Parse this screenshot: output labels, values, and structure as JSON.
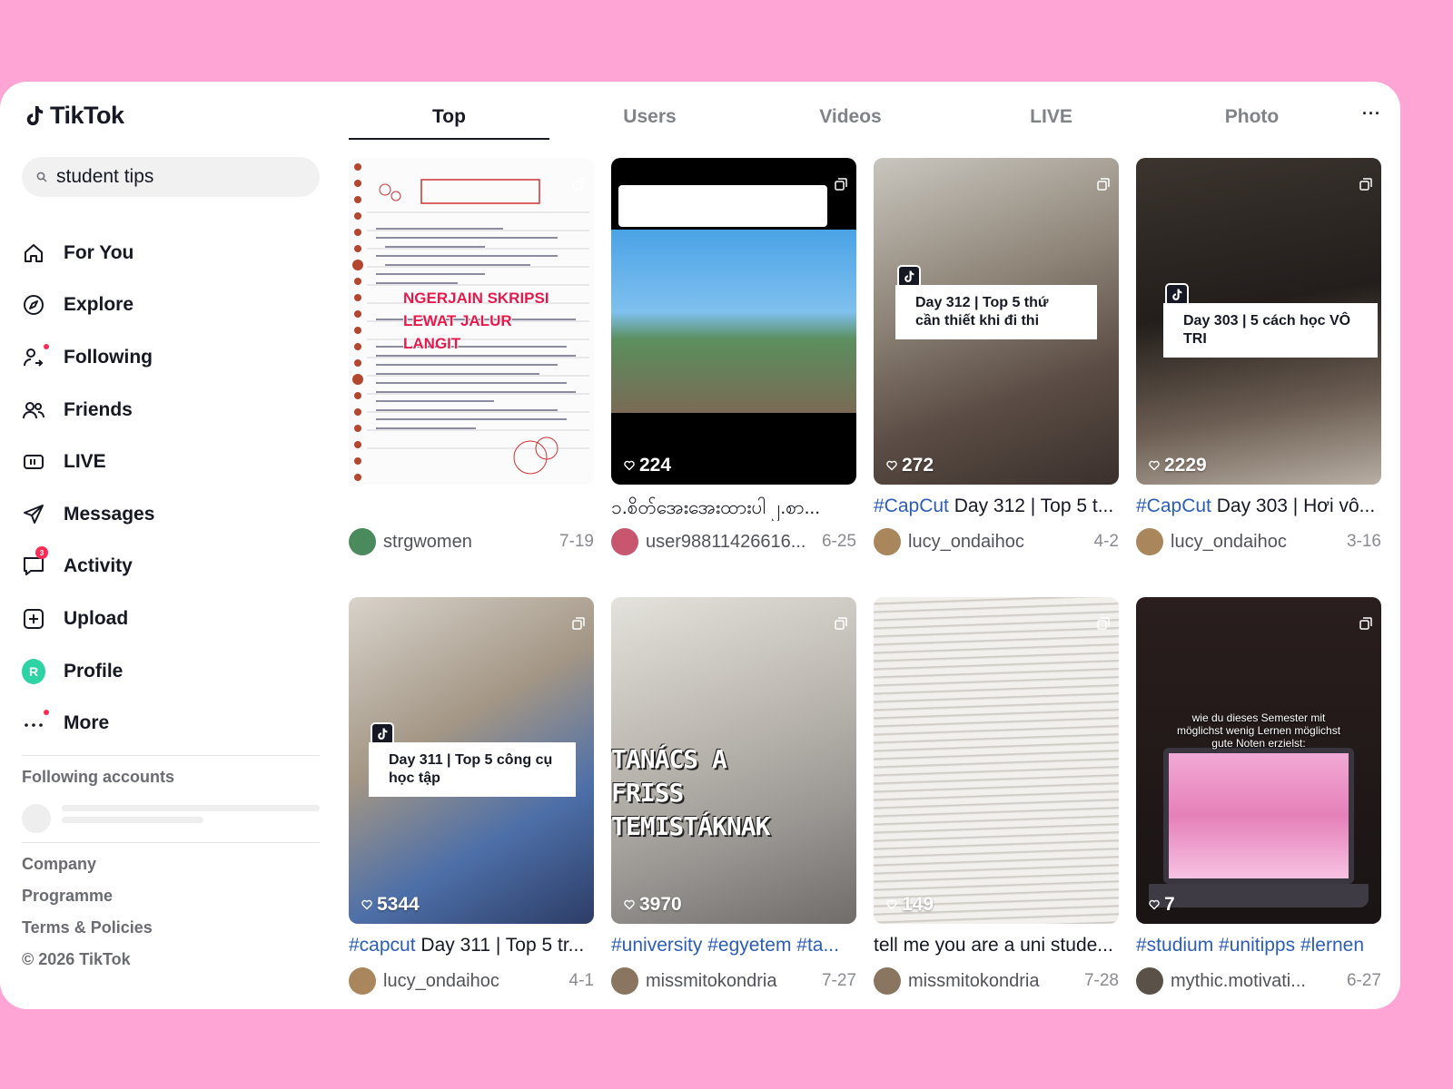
{
  "app": {
    "name": "TikTok"
  },
  "search": {
    "value": "student tips"
  },
  "nav": [
    {
      "label": "For You",
      "icon": "home-icon"
    },
    {
      "label": "Explore",
      "icon": "compass-icon"
    },
    {
      "label": "Following",
      "icon": "following-icon"
    },
    {
      "label": "Friends",
      "icon": "friends-icon"
    },
    {
      "label": "LIVE",
      "icon": "live-icon"
    },
    {
      "label": "Messages",
      "icon": "send-icon"
    },
    {
      "label": "Activity",
      "icon": "inbox-icon",
      "badge": "3"
    },
    {
      "label": "Upload",
      "icon": "upload-icon"
    },
    {
      "label": "Profile",
      "avatar_letter": "R"
    },
    {
      "label": "More",
      "icon": "more-icon"
    }
  ],
  "following_accounts_title": "Following accounts",
  "footer": {
    "company": "Company",
    "programme": "Programme",
    "terms": "Terms & Policies",
    "copyright": "© 2026 TikTok"
  },
  "tabs": [
    "Top",
    "Users",
    "Videos",
    "LIVE",
    "Photo"
  ],
  "colors": {
    "accent": "#fe2c55",
    "hashtag": "#2b5db9",
    "background": "#ffa5d6"
  },
  "videos": [
    {
      "likes": "",
      "caption_tag": "",
      "caption_text": "",
      "user": "strgwomen",
      "date": "7-19",
      "overlay": "",
      "thumb_text": "NGERJAIN SKRIPSI LEWAT JALUR LANGIT"
    },
    {
      "likes": "224",
      "caption_tag": "",
      "caption_text": "၁.စိတ်အေးအေးထားပါ ၂.စာ...",
      "user": "user98811426616...",
      "date": "6-25",
      "overlay": ""
    },
    {
      "likes": "272",
      "caption_tag": "#CapCut",
      "caption_text": " Day 312 | Top 5 t...",
      "user": "lucy_ondaihoc",
      "date": "4-2",
      "overlay": "Day 312 | Top 5 thứ cần thiết khi đi thi"
    },
    {
      "likes": "2229",
      "caption_tag": "#CapCut",
      "caption_text": " Day 303 | Hơi vô...",
      "user": "lucy_ondaihoc",
      "date": "3-16",
      "overlay": "Day 303 | 5 cách học VÔ TRI"
    },
    {
      "likes": "5344",
      "caption_tag": "#capcut",
      "caption_text": " Day 311 | Top 5 tr...",
      "user": "lucy_ondaihoc",
      "date": "4-1",
      "overlay": "Day 311 | Top 5 công cụ học tập"
    },
    {
      "likes": "3970",
      "caption_tag": "#university #egyetem #ta...",
      "caption_text": "",
      "user": "missmitokondria",
      "date": "7-27",
      "overlay": "TANÁCS A FRISS TEMISTÁKNAK"
    },
    {
      "likes": "149",
      "caption_tag": "",
      "caption_text": "tell me you are a uni stude...",
      "user": "missmitokondria",
      "date": "7-28",
      "overlay": ""
    },
    {
      "likes": "7",
      "caption_tag": "#studium #unitipps #lernen",
      "caption_text": "",
      "user": "mythic.motivati...",
      "date": "6-27",
      "overlay": "wie du dieses Semester mit möglichst wenig Lernen möglichst gute Noten erzielst:"
    }
  ]
}
